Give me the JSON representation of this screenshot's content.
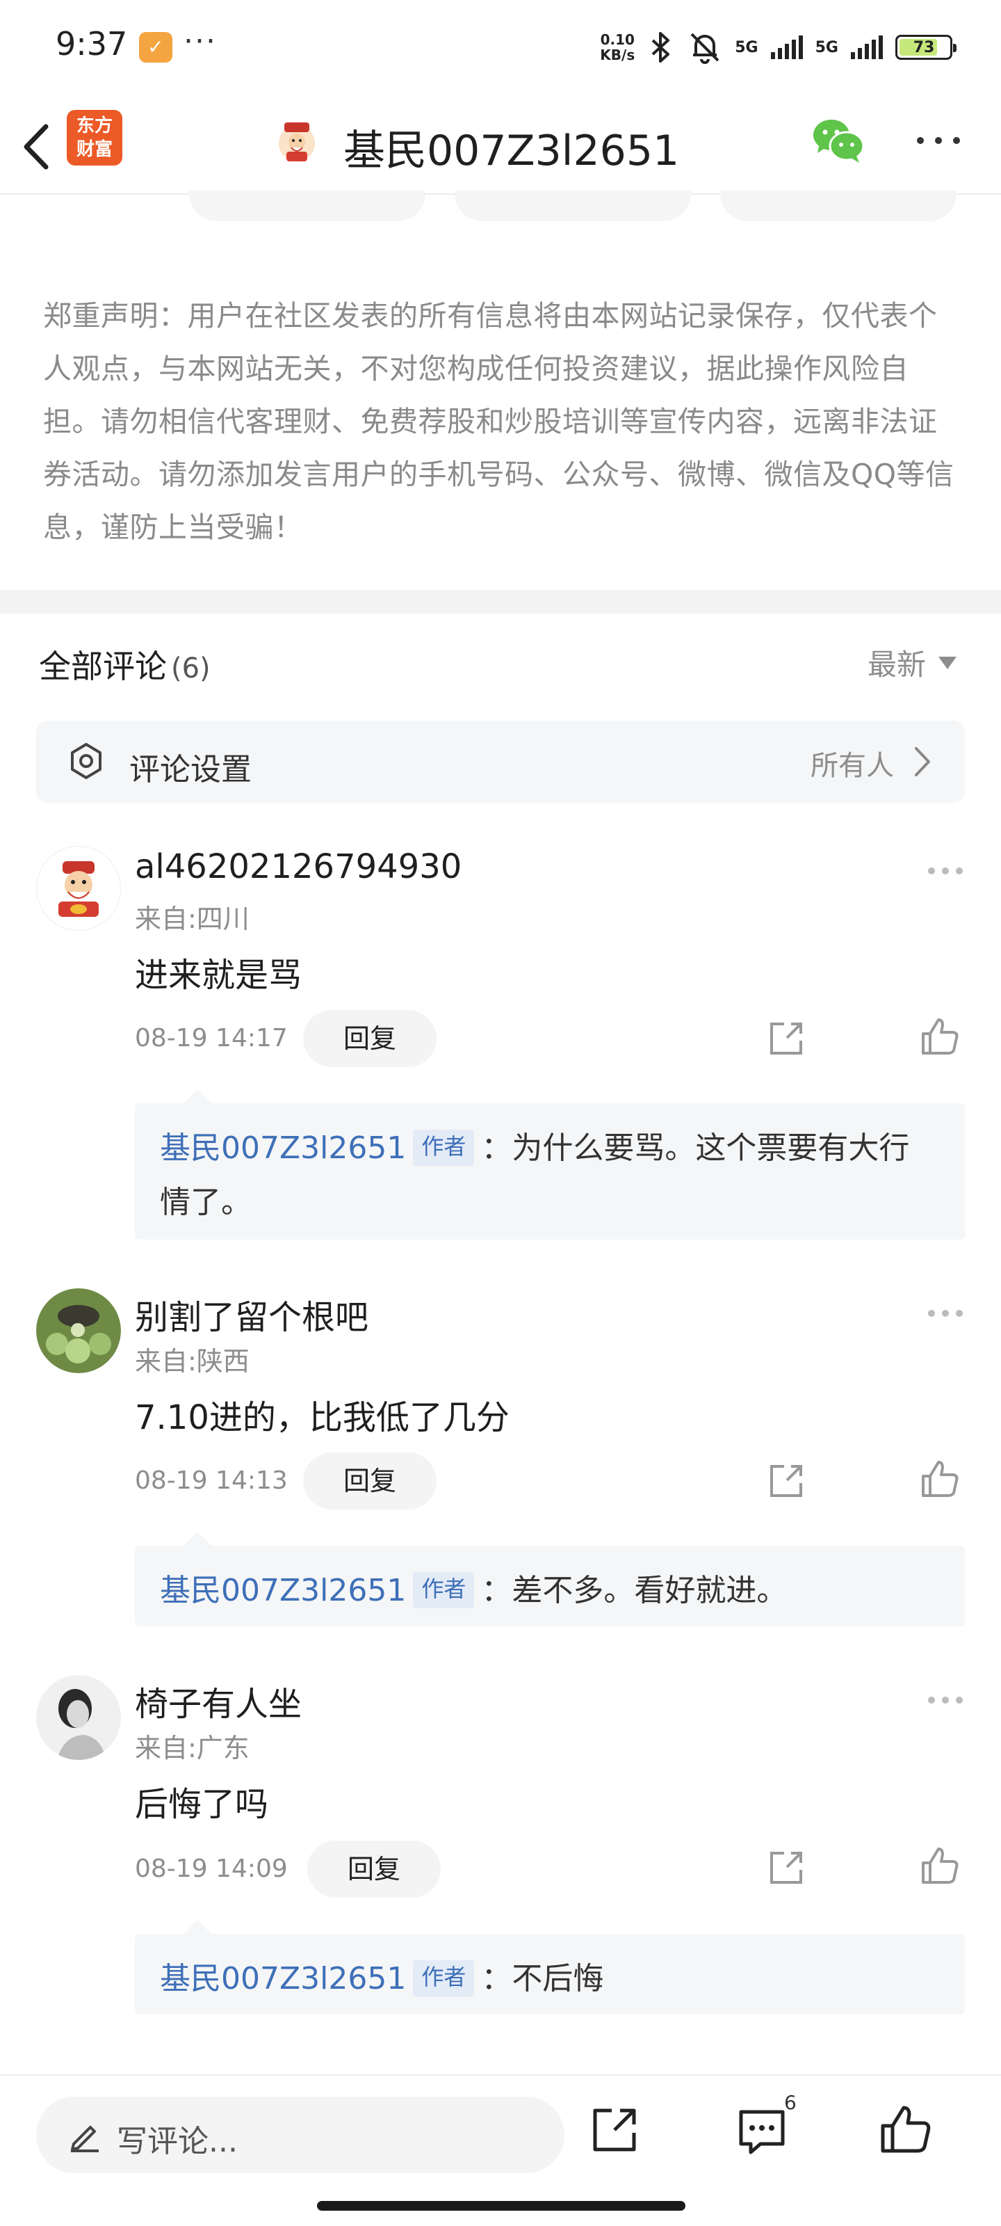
{
  "status_bar": {
    "time": "9:37",
    "more": "···",
    "net_speed_value": "0.10",
    "net_speed_unit": "KB/s",
    "signal1": "5G",
    "signal2": "5G",
    "battery": "73"
  },
  "header": {
    "brand_line1": "东方",
    "brand_line2": "财富",
    "title": "基民007Z3l2651"
  },
  "disclaimer": "郑重声明：用户在社区发表的所有信息将由本网站记录保存，仅代表个人观点，与本网站无关，不对您构成任何投资建议，据此操作风险自担。请勿相信代客理财、免费荐股和炒股培训等宣传内容，远离非法证券活动。请勿添加发言用户的手机号码、公众号、微博、微信及QQ等信息，谨防上当受骗！",
  "comments_header": {
    "title": "全部评论",
    "count": "(6)",
    "sort": "最新"
  },
  "settings": {
    "label": "评论设置",
    "value": "所有人"
  },
  "comments": [
    {
      "user": "al46202126794930",
      "location": "来自:四川",
      "text": "进来就是骂",
      "time": "08-19 14:17",
      "reply_label": "回复",
      "reply": {
        "author": "基民007Z3l2651",
        "badge": "作者",
        "text": "：为什么要骂。这个票要有大行情了。"
      }
    },
    {
      "user": "别割了留个根吧",
      "location": "来自:陕西",
      "text": "7.10进的，比我低了几分",
      "time": "08-19 14:13",
      "reply_label": "回复",
      "reply": {
        "author": "基民007Z3l2651",
        "badge": "作者",
        "text": "：差不多。看好就进。"
      }
    },
    {
      "user": "椅子有人坐",
      "location": "来自:广东",
      "text": "后悔了吗",
      "time": "08-19 14:09",
      "reply_label": "回复",
      "reply": {
        "author": "基民007Z3l2651",
        "badge": "作者",
        "text": "：不后悔"
      }
    }
  ],
  "bottom_bar": {
    "placeholder": "写评论...",
    "comment_count": "6"
  },
  "colors": {
    "author_blue": "#3e6fb8",
    "brand_orange": "#ec5a27",
    "wechat_green": "#5ec44a"
  }
}
